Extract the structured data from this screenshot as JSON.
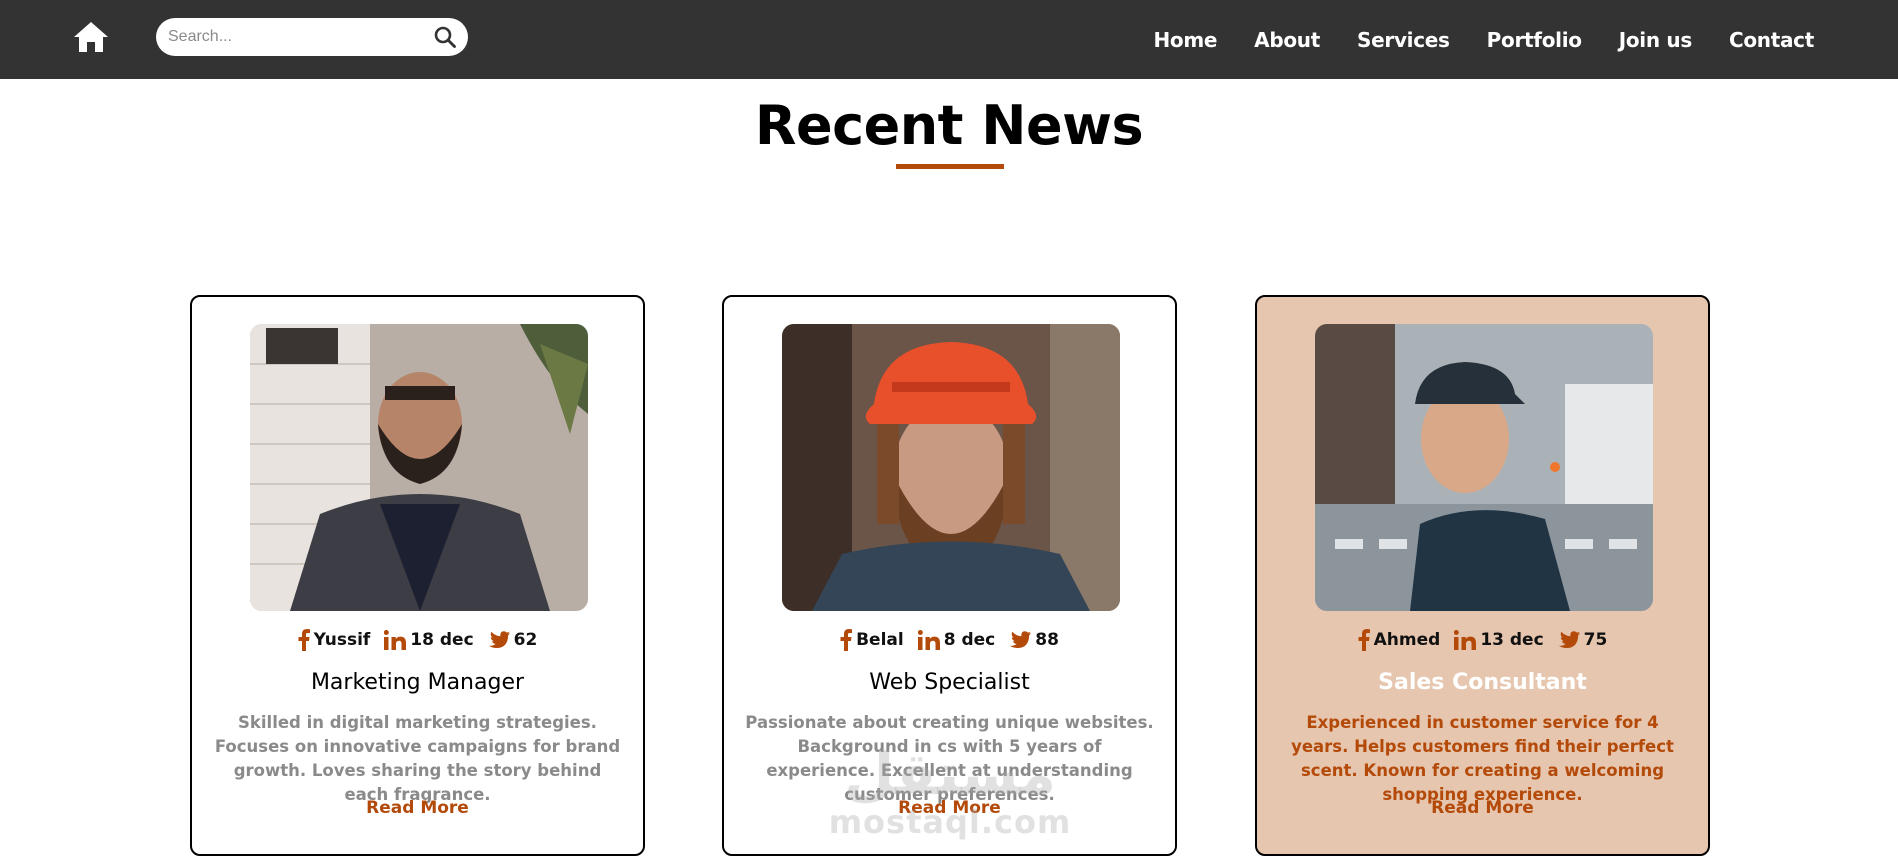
{
  "nav": {
    "home_icon": "home-icon",
    "search_placeholder": "Search...",
    "search_icon": "search-icon",
    "links": [
      "Home",
      "About",
      "Services",
      "Portfolio",
      "Join us",
      "Contact"
    ]
  },
  "section": {
    "title": "Recent News",
    "accent_color": "#b44a0a"
  },
  "cards": [
    {
      "author": "Yussif",
      "date": "18 dec",
      "count": "62",
      "role": "Marketing Manager",
      "description": "Skilled in digital marketing strategies. Focuses on innovative campaigns for brand growth. Loves sharing the story behind each fragrance.",
      "read_more": "Read More",
      "highlighted": false
    },
    {
      "author": "Belal",
      "date": "8 dec",
      "count": "88",
      "role": "Web Specialist",
      "description": "Passionate about creating unique websites. Background in cs with 5 years of experience. Excellent at understanding customer preferences.",
      "read_more": "Read More",
      "highlighted": false
    },
    {
      "author": "Ahmed",
      "date": "13 dec",
      "count": "75",
      "role": "Sales Consultant",
      "description": "Experienced in customer service for 4 years. Helps customers find their perfect scent. Known for creating a welcoming shopping experience.",
      "read_more": "Read More",
      "highlighted": true
    }
  ],
  "icons": {
    "social": [
      "facebook-icon",
      "linkedin-icon",
      "twitter-icon"
    ]
  },
  "watermark": {
    "arabic": "مستقل",
    "latin": "mostaql.com"
  }
}
